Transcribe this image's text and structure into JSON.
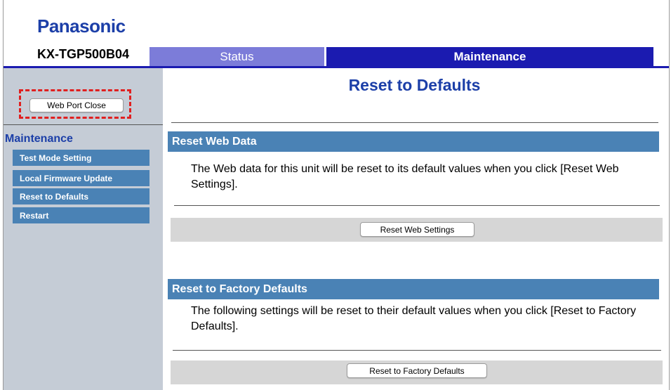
{
  "header": {
    "brand": "Panasonic",
    "model": "KX-TGP500B04",
    "tabs": [
      {
        "label": "Status"
      },
      {
        "label": "Maintenance"
      }
    ]
  },
  "sidebar": {
    "web_port_button": "Web Port Close",
    "section_title": "Maintenance",
    "items": [
      {
        "label": "Test Mode Setting"
      },
      {
        "label": "Local Firmware Update"
      },
      {
        "label": "Reset to Defaults"
      },
      {
        "label": "Restart"
      }
    ]
  },
  "main": {
    "title": "Reset to Defaults",
    "reset_web": {
      "heading": "Reset Web Data",
      "description": "The Web data for this unit will be reset to its default values when you click [Reset Web Settings].",
      "button": "Reset Web Settings"
    },
    "factory": {
      "heading": "Reset to Factory Defaults",
      "description": "The following settings will be reset to their default values when you click [Reset to Factory Defaults].",
      "button": "Reset to Factory Defaults"
    }
  },
  "colors": {
    "brand_blue": "#1c3fa8",
    "active_tab": "#1b1bb0",
    "inactive_tab": "#7c7cd9",
    "section_bar": "#4a82b5",
    "sidebar_bg": "#c5ccd6",
    "highlight_dashed": "#e02020"
  }
}
